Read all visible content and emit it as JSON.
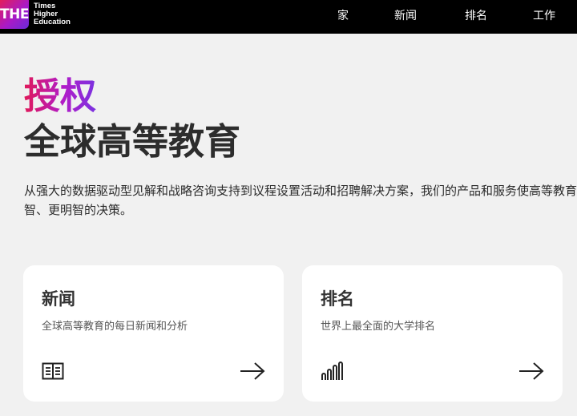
{
  "header": {
    "logo_mark": "THE",
    "logo_lines": [
      "Times",
      "Higher",
      "Education"
    ],
    "nav": [
      "家",
      "新闻",
      "排名",
      "工作"
    ]
  },
  "hero": {
    "accent": "授权",
    "title": "全球高等教育",
    "intro_line1": "从强大的数据驱动型见解和战略咨询支持到议程设置活动和招聘解决方案，我们的产品和服务使高等教育",
    "intro_line2": "智、更明智的决策。"
  },
  "cards": [
    {
      "title": "新闻",
      "desc": "全球高等教育的每日新闻和分析",
      "icon": "newspaper-icon",
      "arrow": "arrow-right-icon"
    },
    {
      "title": "排名",
      "desc": "世界上最全面的大学排名",
      "icon": "bar-chart-icon",
      "arrow": "arrow-right-icon"
    }
  ],
  "colors": {
    "header_bg": "#000000",
    "page_bg": "#f1f1f1",
    "accent_start": "#e0195a",
    "accent_end": "#7a32e0"
  }
}
